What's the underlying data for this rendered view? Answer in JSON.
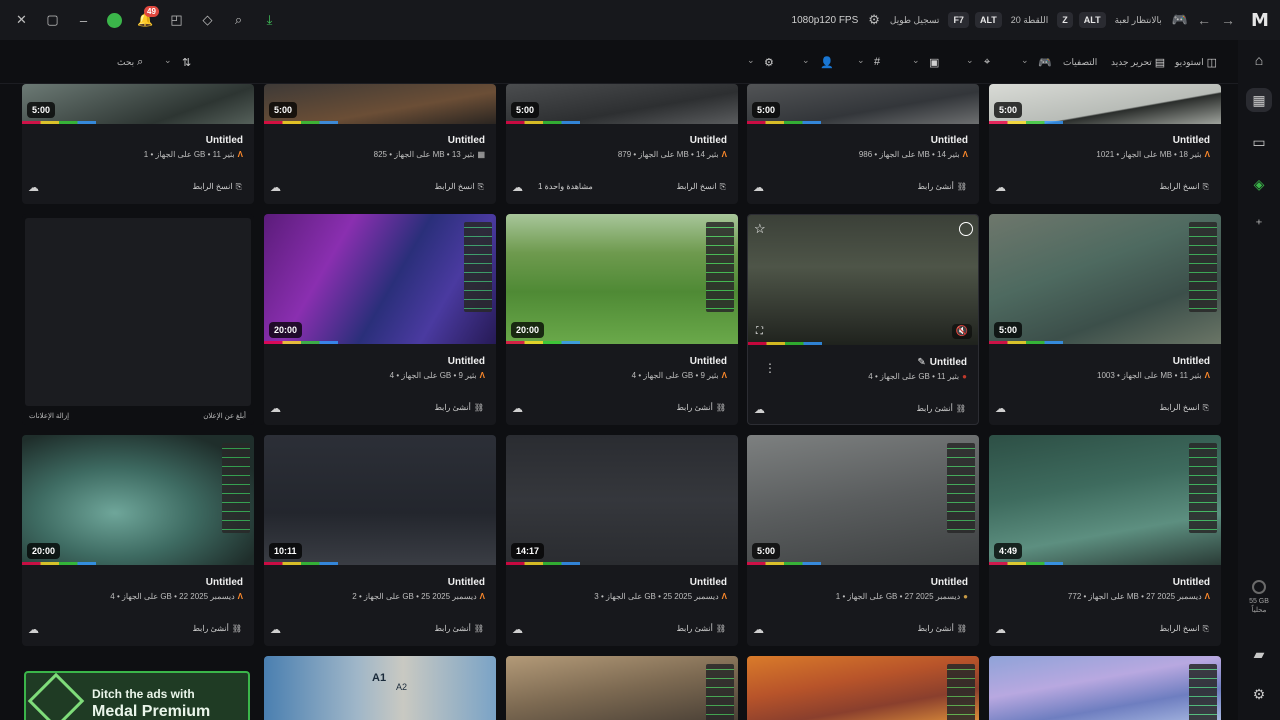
{
  "topbar": {
    "notification_count": "49",
    "fps_label": "1080p120 FPS",
    "record_label": "تسجيل طويل",
    "record_key": "F7",
    "record_mod": "ALT",
    "clip_label": "اللقطة 20",
    "clip_key": "Z",
    "clip_mod": "ALT",
    "waiting_label": "بالانتظار لعبة"
  },
  "toolbar": {
    "capture_label": "استوديو",
    "new_edit_label": "تحرير جديد",
    "filters_label": "التصفيات",
    "search_placeholder": "بحث"
  },
  "rail": {
    "storage_value": "55 GB",
    "storage_label": "محلياً"
  },
  "ad": {
    "remove_label": "إزالة الإعلانات",
    "report_label": "أبلغ عن الإعلان",
    "premium_line1": "Ditch the ads with",
    "premium_line2": "Medal Premium"
  },
  "cards": [
    {
      "duration": "5:00",
      "title": "Untitled",
      "meta": "على الجهاز • 1 GB • بثير 11",
      "action": "انسخ الرابط",
      "icon": "copy"
    },
    {
      "duration": "5:00",
      "title": "Untitled",
      "meta": "على الجهاز • 825 MB • بثير 13",
      "action": "انسخ الرابط",
      "icon": "copy"
    },
    {
      "duration": "5:00",
      "title": "Untitled",
      "meta": "على الجهاز • 879 MB • بثير 14",
      "action": "انسخ الرابط",
      "icon": "copy",
      "views": "1 مشاهدة واحدة"
    },
    {
      "duration": "5:00",
      "title": "Untitled",
      "meta": "على الجهاز • 986 MB • بثير 14",
      "action": "أنشئ رابط",
      "icon": "link"
    },
    {
      "duration": "5:00",
      "title": "Untitled",
      "meta": "على الجهاز • 1021 MB • بثير 18",
      "action": "انسخ الرابط",
      "icon": "copy"
    },
    {
      "duration": "20:00",
      "title": "Untitled",
      "meta": "على الجهاز • 4 GB • بثير 9",
      "action": "أنشئ رابط",
      "icon": "link"
    },
    {
      "duration": "20:00",
      "title": "Untitled",
      "meta": "على الجهاز • 4 GB • بثير 9",
      "action": "أنشئ رابط",
      "icon": "link"
    },
    {
      "duration": "",
      "title": "Untitled",
      "meta": "على الجهاز • 4 GB • بثير 11",
      "action": "أنشئ رابط",
      "icon": "link"
    },
    {
      "duration": "5:00",
      "title": "Untitled",
      "meta": "على الجهاز • 1003 MB • بثير 11",
      "action": "انسخ الرابط",
      "icon": "copy"
    },
    {
      "duration": "20:00",
      "title": "Untitled",
      "meta": "على الجهاز • 4 GB • 22 ديسمبر 2025",
      "action": "أنشئ رابط",
      "icon": "link"
    },
    {
      "duration": "10:11",
      "title": "Untitled",
      "meta": "على الجهاز • 2 GB • 25 ديسمبر 2025",
      "action": "أنشئ رابط",
      "icon": "link"
    },
    {
      "duration": "14:17",
      "title": "Untitled",
      "meta": "على الجهاز • 3 GB • 25 ديسمبر 2025",
      "action": "أنشئ رابط",
      "icon": "link"
    },
    {
      "duration": "5:00",
      "title": "Untitled",
      "meta": "على الجهاز • 1 GB • 27 ديسمبر 2025",
      "action": "أنشئ رابط",
      "icon": "link"
    },
    {
      "duration": "4:49",
      "title": "Untitled",
      "meta": "على الجهاز • 772 MB • 27 ديسمبر 2025",
      "action": "انسخ الرابط",
      "icon": "copy"
    }
  ],
  "bottom_labels": {
    "a1": "A1",
    "a2": "A2"
  }
}
